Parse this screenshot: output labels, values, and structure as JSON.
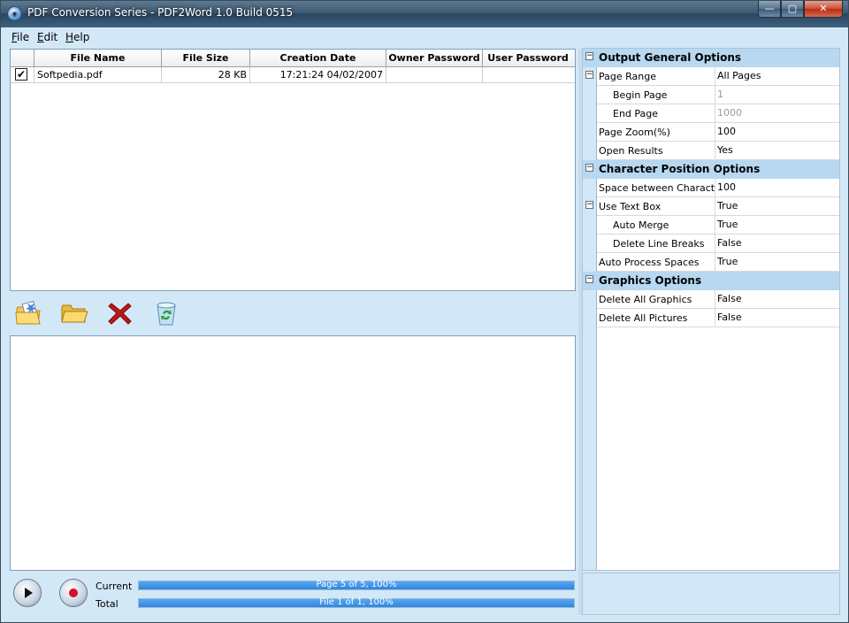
{
  "window": {
    "title": "PDF Conversion Series - PDF2Word 1.0 Build 0515",
    "min": "—",
    "max": "▢",
    "close": "✕"
  },
  "menu": [
    {
      "key": "F",
      "rest": "ile"
    },
    {
      "key": "E",
      "rest": "dit"
    },
    {
      "key": "H",
      "rest": "elp"
    }
  ],
  "filelist": {
    "columns": [
      "File Name",
      "File Size",
      "Creation Date",
      "Owner Password",
      "User Password"
    ],
    "rows": [
      {
        "checked": "✔",
        "name": "Softpedia.pdf",
        "size": "28 KB",
        "date": "17:21:24 04/02/2007",
        "owner": "",
        "user": ""
      }
    ]
  },
  "toolbar": {
    "icons": [
      "add-file-icon",
      "open-folder-icon",
      "delete-icon",
      "clear-recycle-icon"
    ]
  },
  "progress": {
    "current_label": "Current",
    "total_label": "Total",
    "current_text": "Page 5 of 5, 100%",
    "total_text": "File 1 of 1, 100%",
    "current_pct": 100,
    "total_pct": 100
  },
  "options": {
    "general_title": "Output General Options",
    "page_range": {
      "name": "Page Range",
      "value": "All Pages"
    },
    "begin_page": {
      "name": "Begin Page",
      "value": "1"
    },
    "end_page": {
      "name": "End Page",
      "value": "1000"
    },
    "page_zoom": {
      "name": "Page Zoom(%)",
      "value": "100"
    },
    "open_results": {
      "name": "Open Results",
      "value": "Yes"
    },
    "char_title": "Character Position Options",
    "space_chars": {
      "name": "Space between Characters",
      "value": "100"
    },
    "use_text_box": {
      "name": "Use Text Box",
      "value": "True"
    },
    "auto_merge": {
      "name": "Auto Merge",
      "value": "True"
    },
    "delete_line_breaks": {
      "name": "Delete Line Breaks",
      "value": "False"
    },
    "auto_process_spaces": {
      "name": "Auto Process Spaces",
      "value": "True"
    },
    "graphics_title": "Graphics Options",
    "delete_graphics": {
      "name": "Delete All Graphics",
      "value": "False"
    },
    "delete_pictures": {
      "name": "Delete All Pictures",
      "value": "False"
    },
    "collapse_glyph": "−"
  },
  "colors": {
    "accent": "#2e86e0",
    "category_bg": "#b7d8f0",
    "window_bg": "#d3e8f7"
  }
}
